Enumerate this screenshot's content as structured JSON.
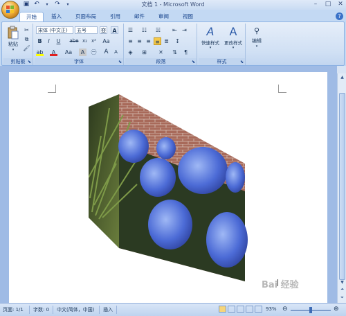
{
  "window": {
    "title": "文档 1 - Microsoft Word",
    "buttons": {
      "minimize": "–",
      "maximize": "□",
      "close": "✕"
    }
  },
  "qat": {
    "save_icon": "save-icon",
    "undo_icon": "undo-icon",
    "redo_icon": "redo-icon"
  },
  "tabs": [
    {
      "label": "开始",
      "active": true
    },
    {
      "label": "插入"
    },
    {
      "label": "页面布局"
    },
    {
      "label": "引用"
    },
    {
      "label": "邮件"
    },
    {
      "label": "审阅"
    },
    {
      "label": "视图"
    }
  ],
  "ribbon": {
    "clipboard": {
      "label": "剪贴板",
      "paste": "粘贴"
    },
    "font": {
      "label": "字体",
      "font_name": "宋体 (中文正)",
      "font_size": "五号",
      "wen": "变",
      "bold": "B",
      "italic": "I",
      "underline": "U",
      "strike": "abe",
      "sub": "x₂",
      "sup": "x²",
      "grow": "A",
      "shrink": "A",
      "change_case": "Aa",
      "char_border": "A"
    },
    "paragraph": {
      "label": "段落"
    },
    "styles": {
      "label": "样式",
      "quick": "快速样式",
      "change": "更改样式"
    },
    "editing": {
      "label": "编辑"
    }
  },
  "status": {
    "page": "页面: 1/1",
    "words": "字数: 0",
    "lang": "中文(简体，中国)",
    "mode": "插入",
    "zoom": "93%"
  },
  "watermark": "Bai 经验",
  "colors": {
    "ribbon_border": "#8db2e3",
    "accent": "#15428b"
  }
}
